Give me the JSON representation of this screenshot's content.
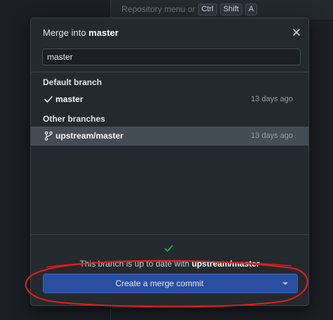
{
  "background": {
    "hint_text": "Repository menu or",
    "keys": [
      "Ctrl",
      "Shift",
      "A"
    ]
  },
  "dialog": {
    "title_prefix": "Merge into",
    "title_branch": "master",
    "filter_value": "master",
    "default_group_label": "Default branch",
    "other_group_label": "Other branches",
    "default_branches": [
      {
        "name": "master",
        "time": "13 days ago",
        "icon": "check-icon"
      }
    ],
    "other_branches": [
      {
        "name": "upstream/master",
        "time": "13 days ago",
        "icon": "git-branch-icon"
      }
    ],
    "status_prefix": "This branch is up to date with",
    "status_branch": "upstream/master",
    "merge_button_label": "Create a merge commit"
  },
  "colors": {
    "accent_button": "#2b4fa0",
    "success": "#28a745",
    "annotation_red": "#e0201b",
    "selected_row": "#444d56"
  }
}
